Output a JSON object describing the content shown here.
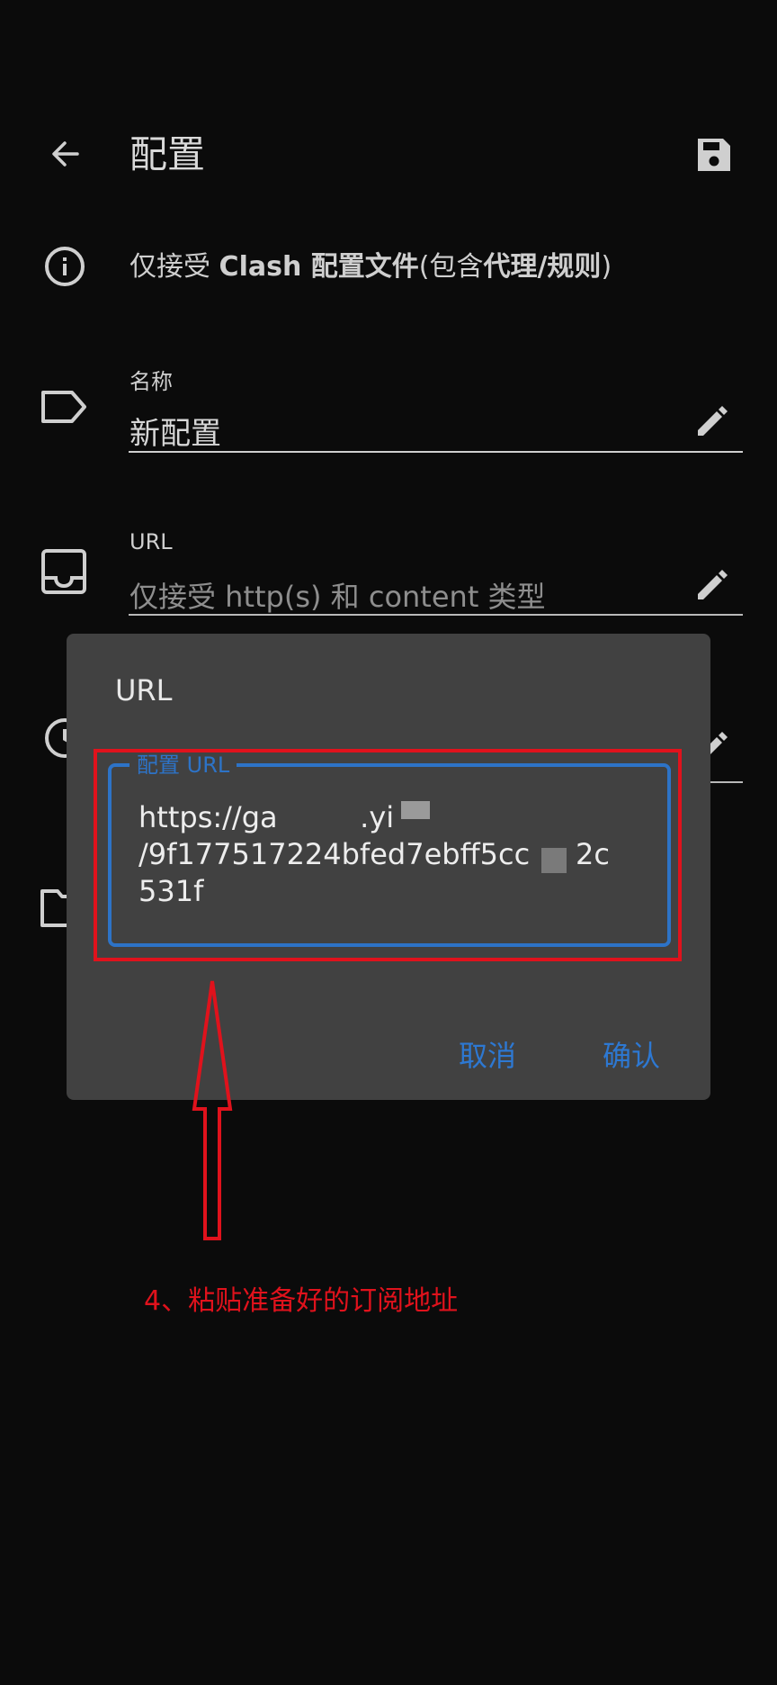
{
  "toolbar": {
    "title": "配置",
    "back_icon": "arrow-back-icon",
    "save_icon": "save-icon"
  },
  "info": {
    "icon": "info-icon",
    "text_prefix": "仅接受 ",
    "text_bold1": "Clash 配置文件",
    "text_mid": "(包含",
    "text_bold2": "代理/规则",
    "text_suffix": ")"
  },
  "fields": {
    "name": {
      "icon": "tag-icon",
      "label": "名称",
      "value": "新配置",
      "edit_icon": "pencil-icon"
    },
    "url": {
      "icon": "inbox-icon",
      "label": "URL",
      "placeholder": "仅接受 http(s) 和 content 类型",
      "edit_icon": "pencil-icon"
    }
  },
  "dialog": {
    "title": "URL",
    "field_label": "配置 URL",
    "field_value": "https://ga         .yi\n/9f177517224bfed7ebff5cc     2c\n531f",
    "cancel_label": "取消",
    "confirm_label": "确认"
  },
  "annotation": {
    "text": "4、粘贴准备好的订阅地址",
    "color": "#e0121c"
  },
  "colors": {
    "background": "#0b0b0b",
    "dialog": "#414141",
    "accent": "#2d78d2",
    "annotation_red": "#e0121c"
  }
}
